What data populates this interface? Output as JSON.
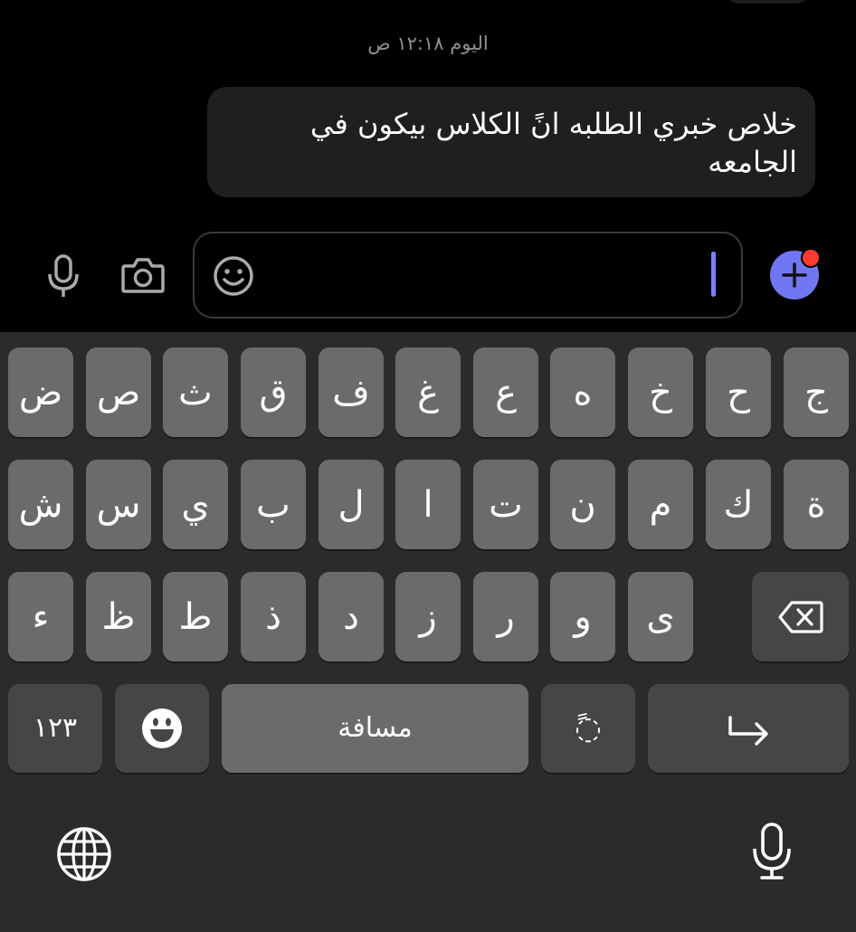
{
  "chat": {
    "timestamp": "اليوم ١٢:١٨ ص",
    "message_line1": "خلاص خبري الطلبه انً الكلاس بيكون في",
    "message_line2": "الجامعه"
  },
  "composer": {
    "icons": {
      "mic": "microphone-icon",
      "camera": "camera-icon",
      "emoji": "smiley-icon",
      "plus": "plus-icon"
    },
    "accent_color": "#7177f4",
    "badge_color": "#ff3b30"
  },
  "keyboard": {
    "row1": [
      "ج",
      "ح",
      "خ",
      "ه",
      "ع",
      "غ",
      "ف",
      "ق",
      "ث",
      "ص",
      "ض"
    ],
    "row2": [
      "ة",
      "ك",
      "م",
      "ن",
      "ت",
      "ا",
      "ل",
      "ب",
      "ي",
      "س",
      "ش"
    ],
    "row3": [
      "ى",
      "و",
      "ر",
      "ز",
      "د",
      "ذ",
      "ط",
      "ظ",
      "ء"
    ],
    "numbers_label": "١٢٣",
    "space_label": "مسافة",
    "tanween_label": "ً◌",
    "icons": {
      "delete": "backspace-icon",
      "emoji": "emoji-face-icon",
      "return": "return-arrow-icon",
      "globe": "globe-icon",
      "dictation": "microphone-icon"
    }
  }
}
